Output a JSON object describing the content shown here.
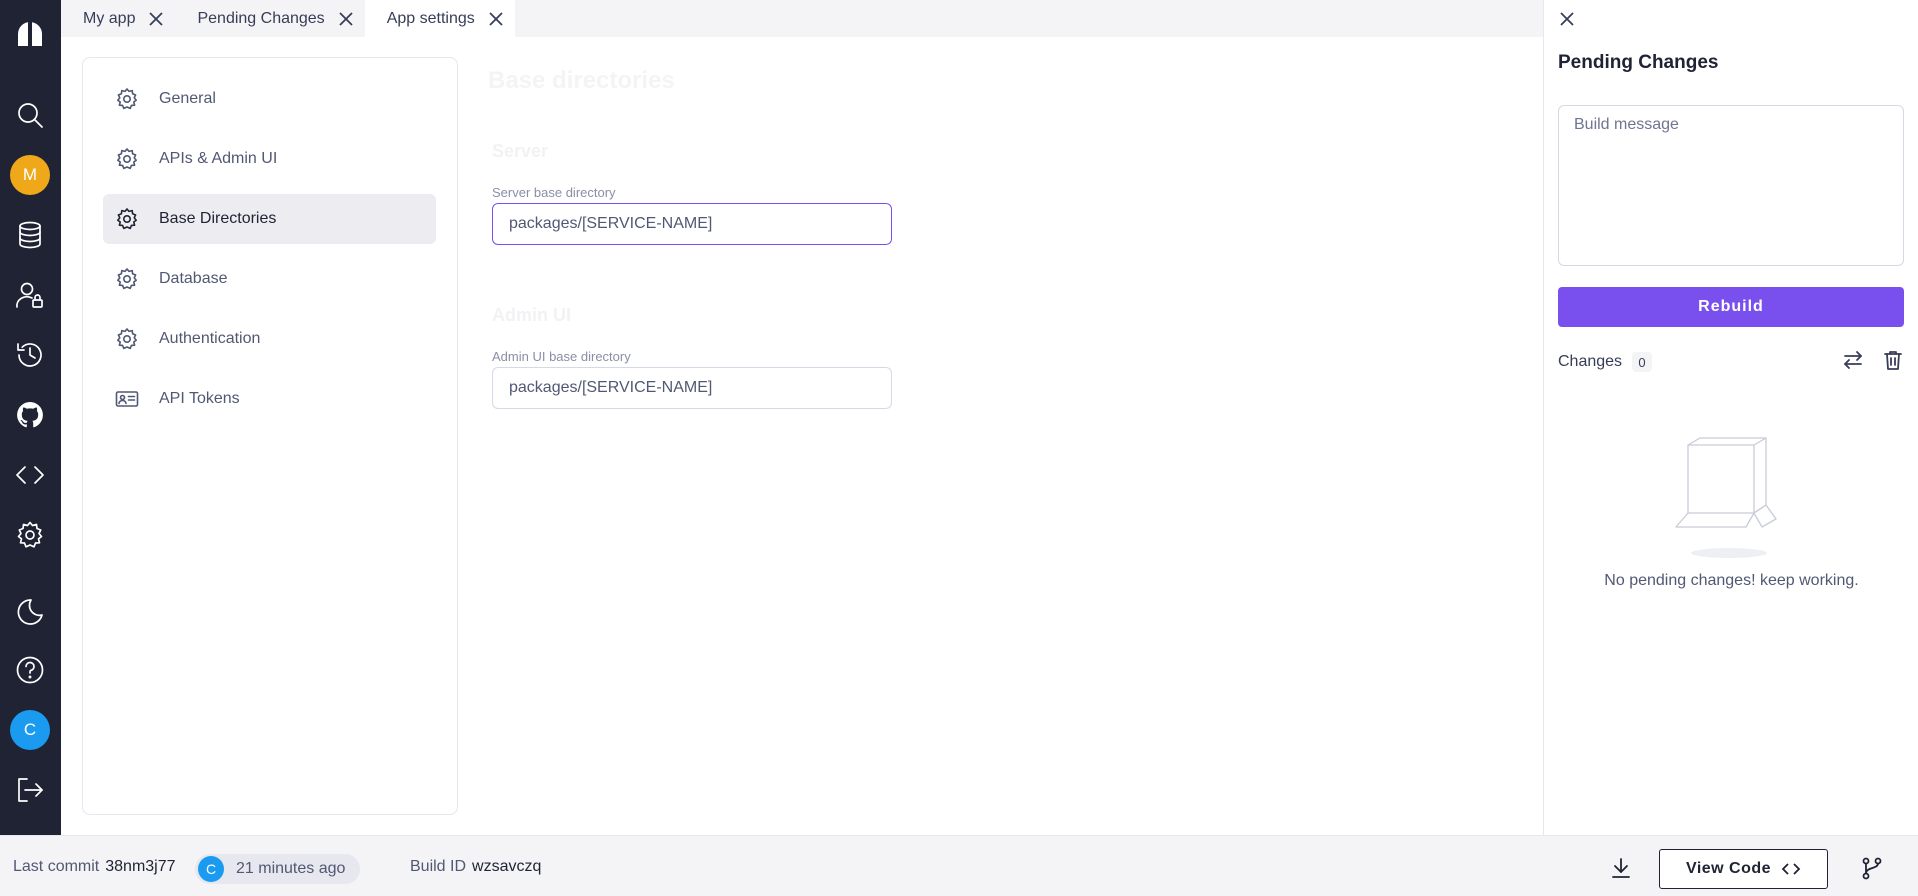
{
  "tabs": [
    {
      "label": "My app"
    },
    {
      "label": "Pending Changes"
    },
    {
      "label": "App settings"
    }
  ],
  "rail": {
    "user_initial": "M",
    "user_color": "#f0a81b",
    "account_initial": "C",
    "account_color": "#1a9bf0"
  },
  "settings_nav": [
    {
      "label": "General",
      "icon": "gear-icon"
    },
    {
      "label": "APIs & Admin UI",
      "icon": "gear-icon"
    },
    {
      "label": "Base Directories",
      "icon": "gear-icon",
      "selected": true
    },
    {
      "label": "Database",
      "icon": "gear-icon"
    },
    {
      "label": "Authentication",
      "icon": "gear-icon"
    },
    {
      "label": "API Tokens",
      "icon": "id-card-icon"
    }
  ],
  "content": {
    "title": "Base directories",
    "server_section": "Server",
    "server_label": "Server base directory",
    "server_value": "packages/[SERVICE-NAME]",
    "admin_section": "Admin UI",
    "admin_label": "Admin UI base directory",
    "admin_value": "packages/[SERVICE-NAME]"
  },
  "panel": {
    "title": "Pending Changes",
    "message_placeholder": "Build message",
    "rebuild_label": "Rebuild",
    "changes_label": "Changes",
    "changes_count": "0",
    "empty_text": "No pending changes! keep working."
  },
  "footer": {
    "last_commit_label": "Last commit",
    "last_commit_id": "38nm3j77",
    "commit_author_initial": "C",
    "commit_time": "21 minutes ago",
    "build_id_label": "Build ID",
    "build_id": "wzsavczq",
    "view_code_label": "View Code"
  },
  "colors": {
    "accent": "#7950ed",
    "rail_bg": "#1f2333"
  }
}
